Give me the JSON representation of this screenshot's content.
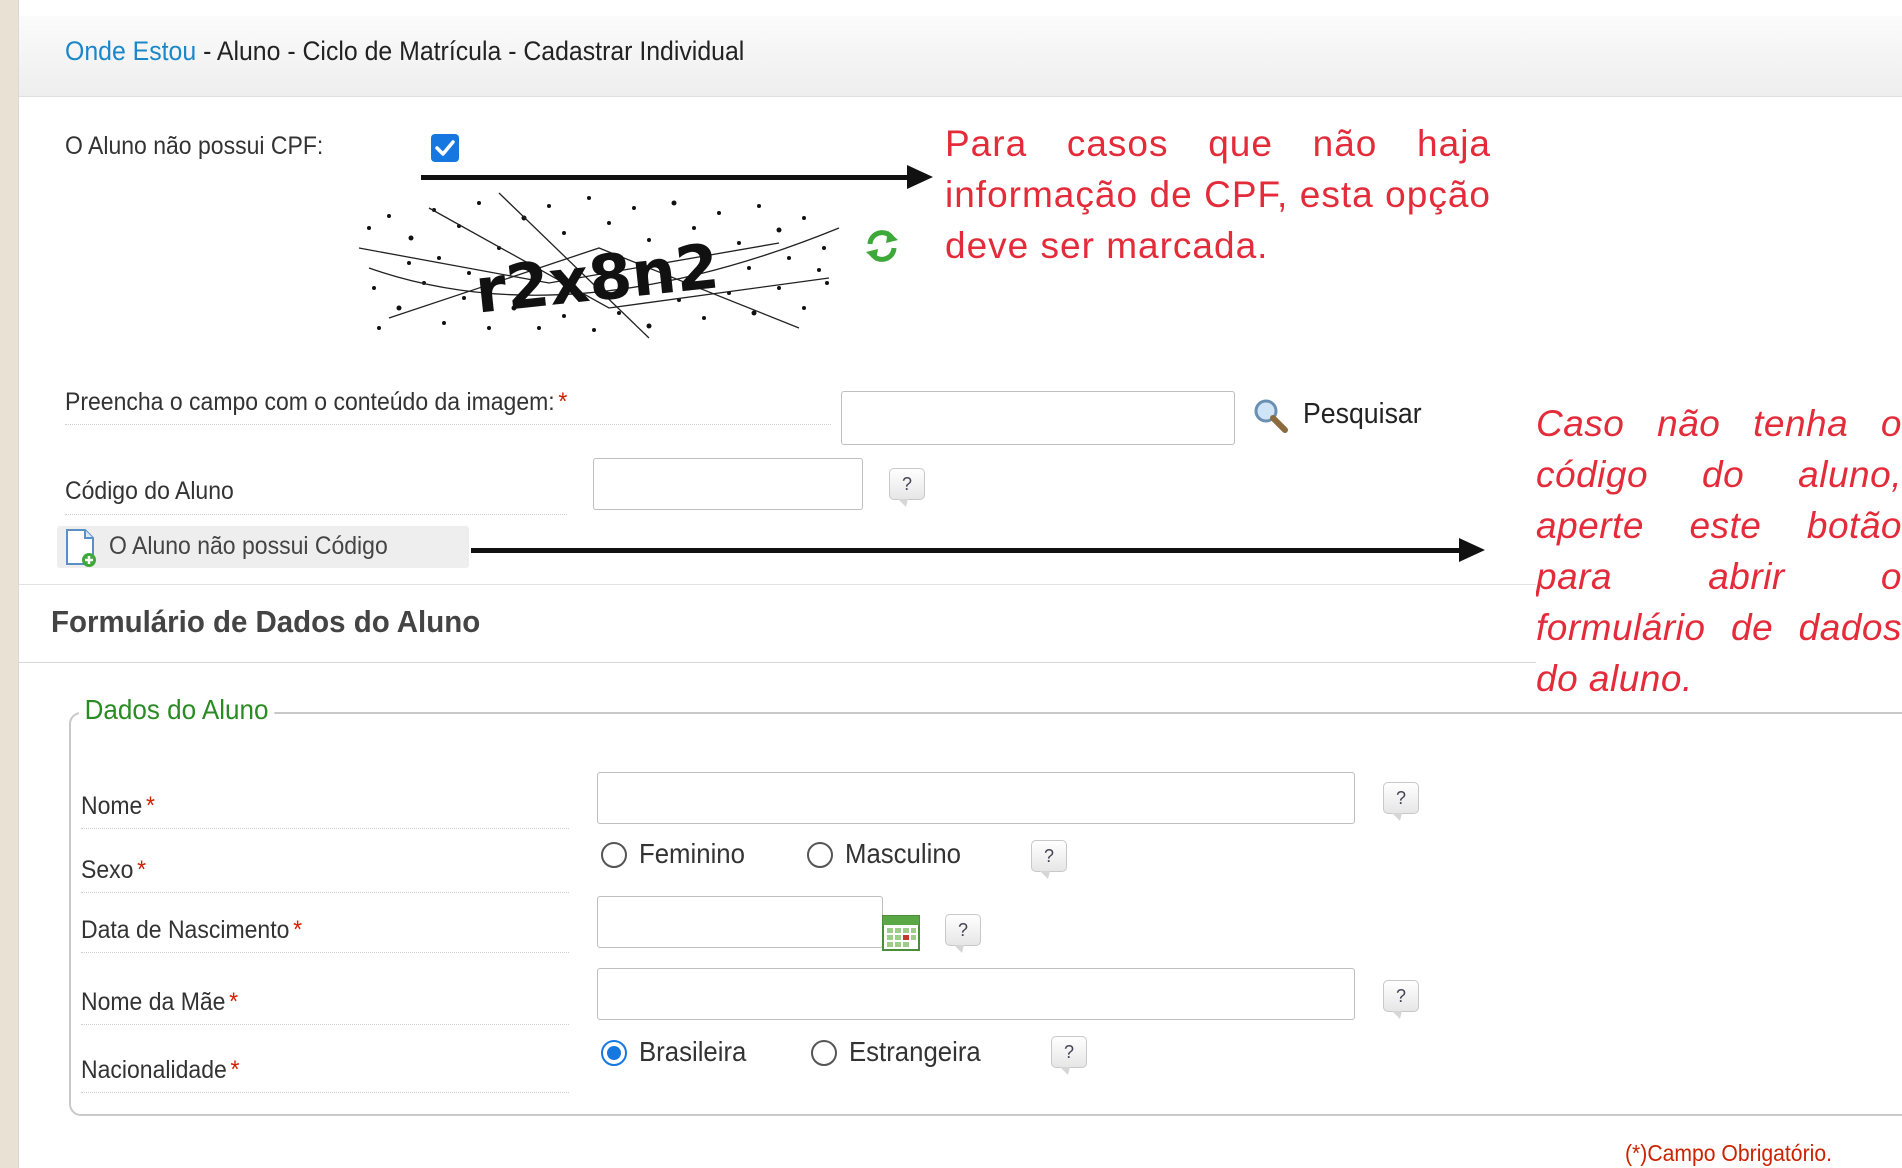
{
  "breadcrumb": {
    "link": "Onde Estou",
    "path": " - Aluno - Ciclo de Matrícula - Cadastrar Individual"
  },
  "cpf": {
    "label": "O Aluno não possui CPF:",
    "checked": true
  },
  "captcha": {
    "text": "r2x8n2",
    "refresh_icon": "refresh-icon"
  },
  "captcha_field": {
    "label": "Preencha o campo com o conteúdo da imagem:",
    "required_mark": "*",
    "value": ""
  },
  "search": {
    "label": "Pesquisar",
    "icon": "search-icon"
  },
  "student_code": {
    "label": "Código do Aluno",
    "value": "",
    "help": "?"
  },
  "no_code_button": {
    "label": "O Aluno não possui Código",
    "icon": "new-document-icon"
  },
  "form_title": "Formulário de Dados do Aluno",
  "fieldset": {
    "legend": "Dados do Aluno",
    "nome": {
      "label": "Nome",
      "value": ""
    },
    "sexo": {
      "label": "Sexo",
      "options": [
        "Feminino",
        "Masculino"
      ],
      "selected": null
    },
    "nascimento": {
      "label": "Data de Nascimento",
      "value": "",
      "icon": "calendar-icon"
    },
    "mae": {
      "label": "Nome da Mãe",
      "value": ""
    },
    "nacionalidade": {
      "label": "Nacionalidade",
      "options": [
        "Brasileira",
        "Estrangeira"
      ],
      "selected": "Brasileira"
    },
    "required_mark": "*",
    "help": "?"
  },
  "annotations": {
    "cpf_note": "Para casos que não haja informação de CPF, esta opção deve ser marcada.",
    "code_note": "Caso não tenha o código do aluno, aperte este botão para abrir o formulário de dados do aluno."
  },
  "footer": "(*)Campo Obrigatório.",
  "colors": {
    "link": "#1a87c9",
    "annotation": "#e32b3a",
    "legend": "#2a8b25",
    "required": "#cc2200",
    "accent": "#1677e0"
  }
}
